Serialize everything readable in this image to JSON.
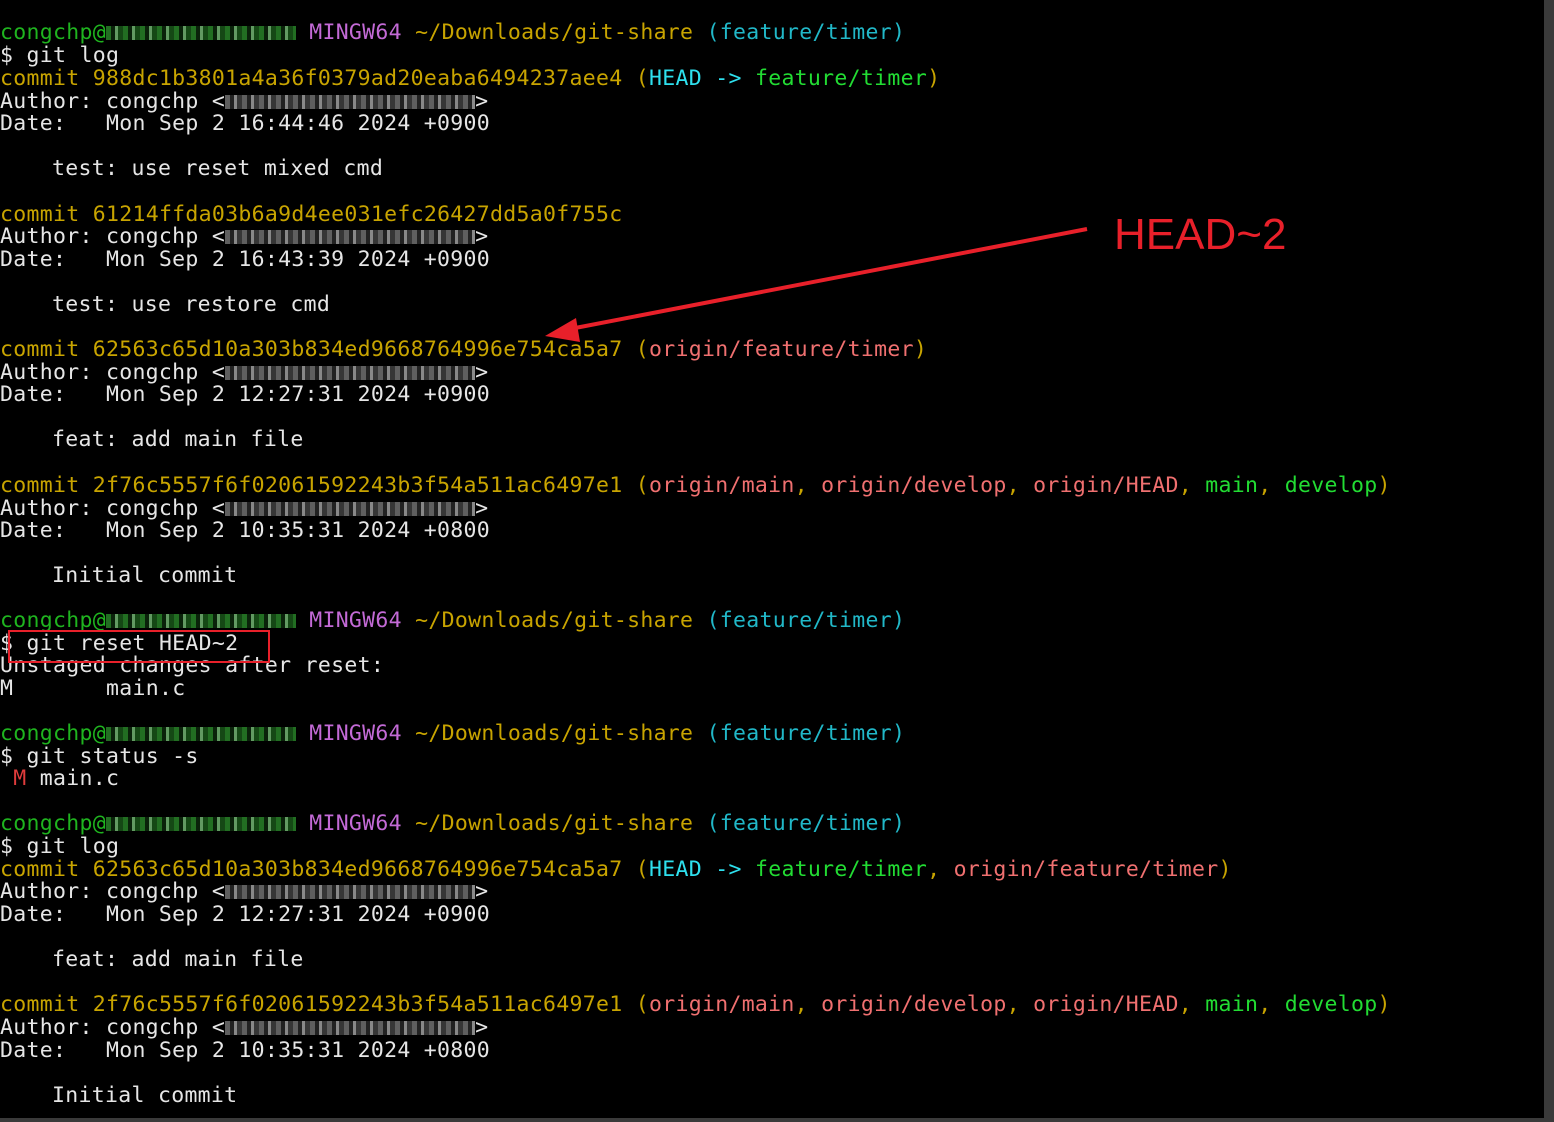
{
  "prompt": {
    "user": "congchp@",
    "env": "MINGW64",
    "path": "~/Downloads/git-share",
    "branch": "(feature/timer)",
    "symbol": "$"
  },
  "commands": {
    "git_log": "git log",
    "git_reset": "git reset HEAD~2",
    "git_status": "git status -s"
  },
  "labels": {
    "commit": "commit",
    "author": "Author: congchp <",
    "author_close": ">",
    "date": "Date:   "
  },
  "log1": [
    {
      "hash": "988dc1b3801a4a36f0379ad20eaba6494237aee4",
      "date": "Mon Sep 2 16:44:46 2024 +0900",
      "message": "test: use reset mixed cmd"
    },
    {
      "hash": "61214ffda03b6a9d4ee031efc26427dd5a0f755c",
      "date": "Mon Sep 2 16:43:39 2024 +0900",
      "message": "test: use restore cmd"
    },
    {
      "hash": "62563c65d10a303b834ed9668764996e754ca5a7",
      "date": "Mon Sep 2 12:27:31 2024 +0900",
      "message": "feat: add main file"
    },
    {
      "hash": "2f76c5557f6f02061592243b3f54a511ac6497e1",
      "date": "Mon Sep 2 10:35:31 2024 +0800",
      "message": "Initial commit"
    }
  ],
  "log2": [
    {
      "hash": "62563c65d10a303b834ed9668764996e754ca5a7",
      "date": "Mon Sep 2 12:27:31 2024 +0900",
      "message": "feat: add main file"
    },
    {
      "hash": "2f76c5557f6f02061592243b3f54a511ac6497e1",
      "date": "Mon Sep 2 10:35:31 2024 +0800",
      "message": "Initial commit"
    }
  ],
  "refs": {
    "open": "(",
    "close": ")",
    "comma": ", ",
    "arrow": " -> ",
    "head": "HEAD",
    "feature_timer": "feature/timer",
    "origin_feature_timer": "origin/feature/timer",
    "origin_main": "origin/main",
    "origin_develop": "origin/develop",
    "origin_head": "origin/HEAD",
    "main": "main",
    "develop": "develop"
  },
  "reset_output": {
    "header": "Unstaged changes after reset:",
    "status": "M",
    "file": "main.c"
  },
  "status_output": {
    "status": " M",
    "file": "main.c"
  },
  "annotation": {
    "label": "HEAD~2",
    "color": "#e8202a"
  }
}
